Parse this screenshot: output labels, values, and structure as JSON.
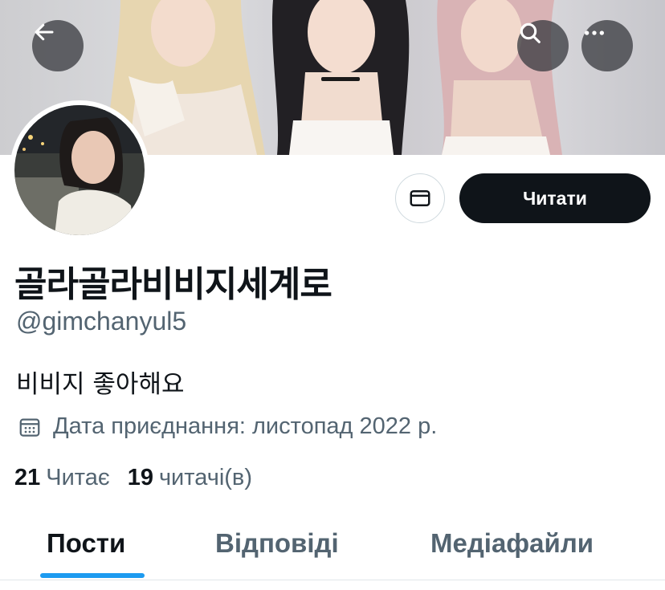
{
  "header": {
    "back_icon": "arrow-left-icon",
    "search_icon": "search-icon",
    "more_icon": "more-horizontal-icon"
  },
  "profile": {
    "display_name": "골라골라비비지세계로",
    "handle": "@gimchanyul5",
    "bio": "비비지 좋아해요",
    "joined": "Дата приєднання: листопад 2022 р.",
    "following_count": "21",
    "following_label": "Читає",
    "followers_count": "19",
    "followers_label": "читачі(в)"
  },
  "actions": {
    "message_icon": "envelope-icon",
    "follow_label": "Читати"
  },
  "tabs": [
    {
      "label": "Пости",
      "active": true
    },
    {
      "label": "Відповіді",
      "active": false
    },
    {
      "label": "Медіафайли",
      "active": false
    }
  ],
  "colors": {
    "accent": "#1d9bf0",
    "text_primary": "#0f1419",
    "text_secondary": "#536471",
    "follow_button_bg": "#0f1419"
  }
}
